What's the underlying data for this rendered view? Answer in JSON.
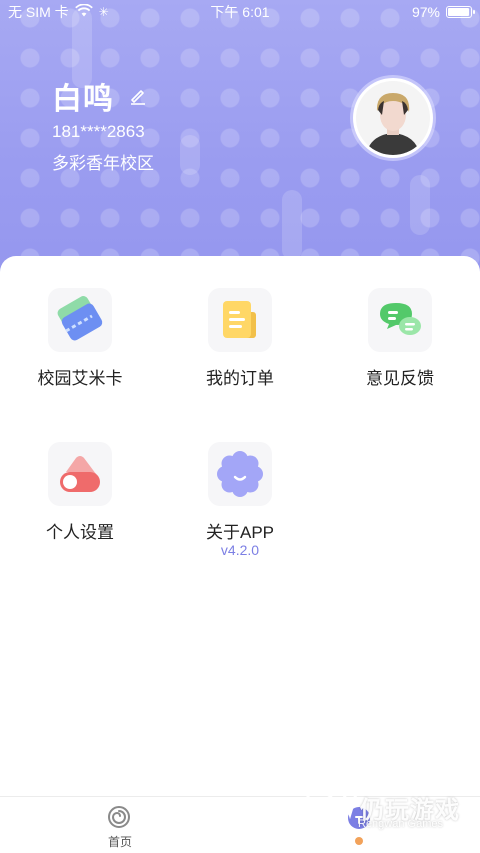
{
  "status_bar": {
    "carrier": "无 SIM 卡",
    "time": "下午 6:01",
    "battery": "97%",
    "battery_level": 0.97
  },
  "profile": {
    "name": "白鸣",
    "phone": "181****2863",
    "campus": "多彩香年校区"
  },
  "menu": {
    "campus_card": "校园艾米卡",
    "orders": "我的订单",
    "feedback": "意见反馈",
    "settings": "个人设置",
    "about": "关于APP",
    "version": "v4.2.0"
  },
  "tabbar": {
    "home": "首页"
  },
  "watermark": {
    "text": "仍玩游戏",
    "sub": "Rengwan Games"
  },
  "colors": {
    "header": "#9a9cf0",
    "accent": "#7c7fe4",
    "badge": "#f2a25a"
  }
}
